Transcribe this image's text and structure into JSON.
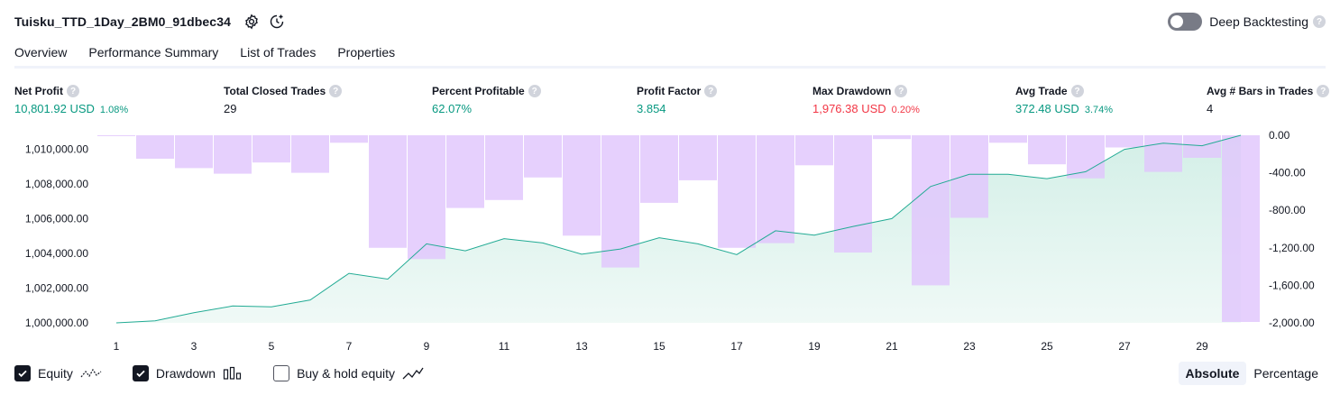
{
  "header": {
    "strategy_name": "Tuisku_TTD_1Day_2BM0_91dbec34",
    "deep_backtesting_label": "Deep Backtesting",
    "help_glyph": "?"
  },
  "tabs": [
    {
      "label": "Overview",
      "active": true
    },
    {
      "label": "Performance Summary",
      "active": false
    },
    {
      "label": "List of Trades",
      "active": false
    },
    {
      "label": "Properties",
      "active": false
    }
  ],
  "metrics": [
    {
      "label": "Net Profit",
      "value": "10,801.92 USD",
      "pct": "1.08%",
      "color": "green"
    },
    {
      "label": "Total Closed Trades",
      "value": "29",
      "pct": "",
      "color": "dark"
    },
    {
      "label": "Percent Profitable",
      "value": "62.07%",
      "pct": "",
      "color": "green"
    },
    {
      "label": "Profit Factor",
      "value": "3.854",
      "pct": "",
      "color": "green"
    },
    {
      "label": "Max Drawdown",
      "value": "1,976.38 USD",
      "pct": "0.20%",
      "color": "red"
    },
    {
      "label": "Avg Trade",
      "value": "372.48 USD",
      "pct": "3.74%",
      "color": "green"
    },
    {
      "label": "Avg # Bars in Trades",
      "value": "4",
      "pct": "",
      "color": "dark"
    }
  ],
  "colors": {
    "green": "#089981",
    "red": "#f23645",
    "equity_line": "#22ab94",
    "equity_fill": "#d3efe7",
    "drawdown_bar": "#e1c6fc",
    "drawdown_overlap": "#b3b6ea"
  },
  "chart_data": {
    "type": "area",
    "x_ticks": [
      "1",
      "3",
      "5",
      "7",
      "9",
      "11",
      "13",
      "15",
      "17",
      "19",
      "21",
      "23",
      "25",
      "27",
      "29"
    ],
    "y_left_ticks": [
      "1,010,000.00",
      "1,008,000.00",
      "1,006,000.00",
      "1,004,000.00",
      "1,002,000.00",
      "1,000,000.00"
    ],
    "y_right_ticks": [
      "0.00",
      "-400.00",
      "-800.00",
      "-1,200.00",
      "-1,600.00",
      "-2,000.00"
    ],
    "ylim_left": [
      1000000,
      1010800
    ],
    "ylim_right": [
      -2000,
      0
    ],
    "series": [
      {
        "name": "Equity",
        "type": "area",
        "x": [
          1,
          2,
          3,
          4,
          5,
          6,
          7,
          8,
          9,
          10,
          11,
          12,
          13,
          14,
          15,
          16,
          17,
          18,
          19,
          20,
          21,
          22,
          23,
          24,
          25,
          26,
          27,
          28,
          29,
          30
        ],
        "values": [
          1000000,
          1000120,
          1000580,
          1000970,
          1000920,
          1001320,
          1002850,
          1002520,
          1004550,
          1004150,
          1004850,
          1004600,
          1003950,
          1004250,
          1004900,
          1004550,
          1003930,
          1005300,
          1005050,
          1005550,
          1006000,
          1007850,
          1008550,
          1008550,
          1008300,
          1008700,
          1009990,
          1010350,
          1010200,
          1010800
        ]
      },
      {
        "name": "Drawdown",
        "type": "bar",
        "x": [
          1,
          2,
          3,
          4,
          5,
          6,
          7,
          8,
          9,
          10,
          11,
          12,
          13,
          14,
          15,
          16,
          17,
          18,
          19,
          20,
          21,
          22,
          23,
          24,
          25,
          26,
          27,
          28,
          29,
          30
        ],
        "values": [
          -8,
          -250,
          -350,
          -410,
          -290,
          -400,
          -80,
          -1200,
          -1320,
          -775,
          -690,
          -450,
          -1070,
          -1410,
          -720,
          -480,
          -1200,
          -1150,
          -320,
          -1250,
          -40,
          -1600,
          -880,
          -80,
          -310,
          -460,
          -130,
          -390,
          -240,
          -1990
        ]
      }
    ]
  },
  "legend": {
    "items": [
      {
        "label": "Equity",
        "checked": true
      },
      {
        "label": "Drawdown",
        "checked": true
      },
      {
        "label": "Buy & hold equity",
        "checked": false
      }
    ]
  },
  "modes": [
    {
      "label": "Absolute",
      "active": true
    },
    {
      "label": "Percentage",
      "active": false
    }
  ]
}
